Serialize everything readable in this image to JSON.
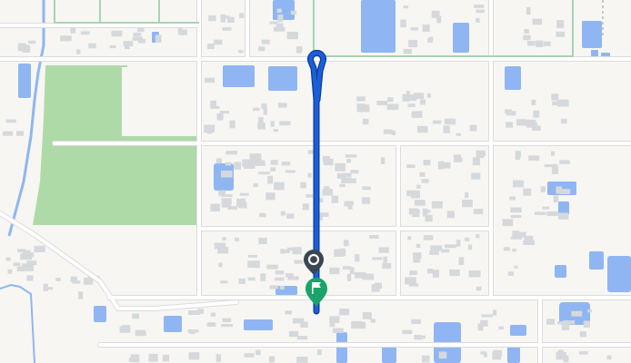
{
  "map": {
    "colors": {
      "background": "#f7f6f3",
      "road": "#ffffff",
      "road_edge": "#dcdcdc",
      "park": "#aedaa8",
      "water": "#8fb6f2",
      "building": "#d6d9dc",
      "rail": "#a7d4b3",
      "route": "#1a5fd6",
      "route_outline": "#0d3a9c"
    },
    "markers": {
      "start": {
        "name": "start-marker",
        "icon": "location-pin-icon",
        "color": "#3a4750"
      },
      "end": {
        "name": "destination-marker",
        "icon": "flag-icon",
        "color": "#1aa36a"
      }
    }
  }
}
